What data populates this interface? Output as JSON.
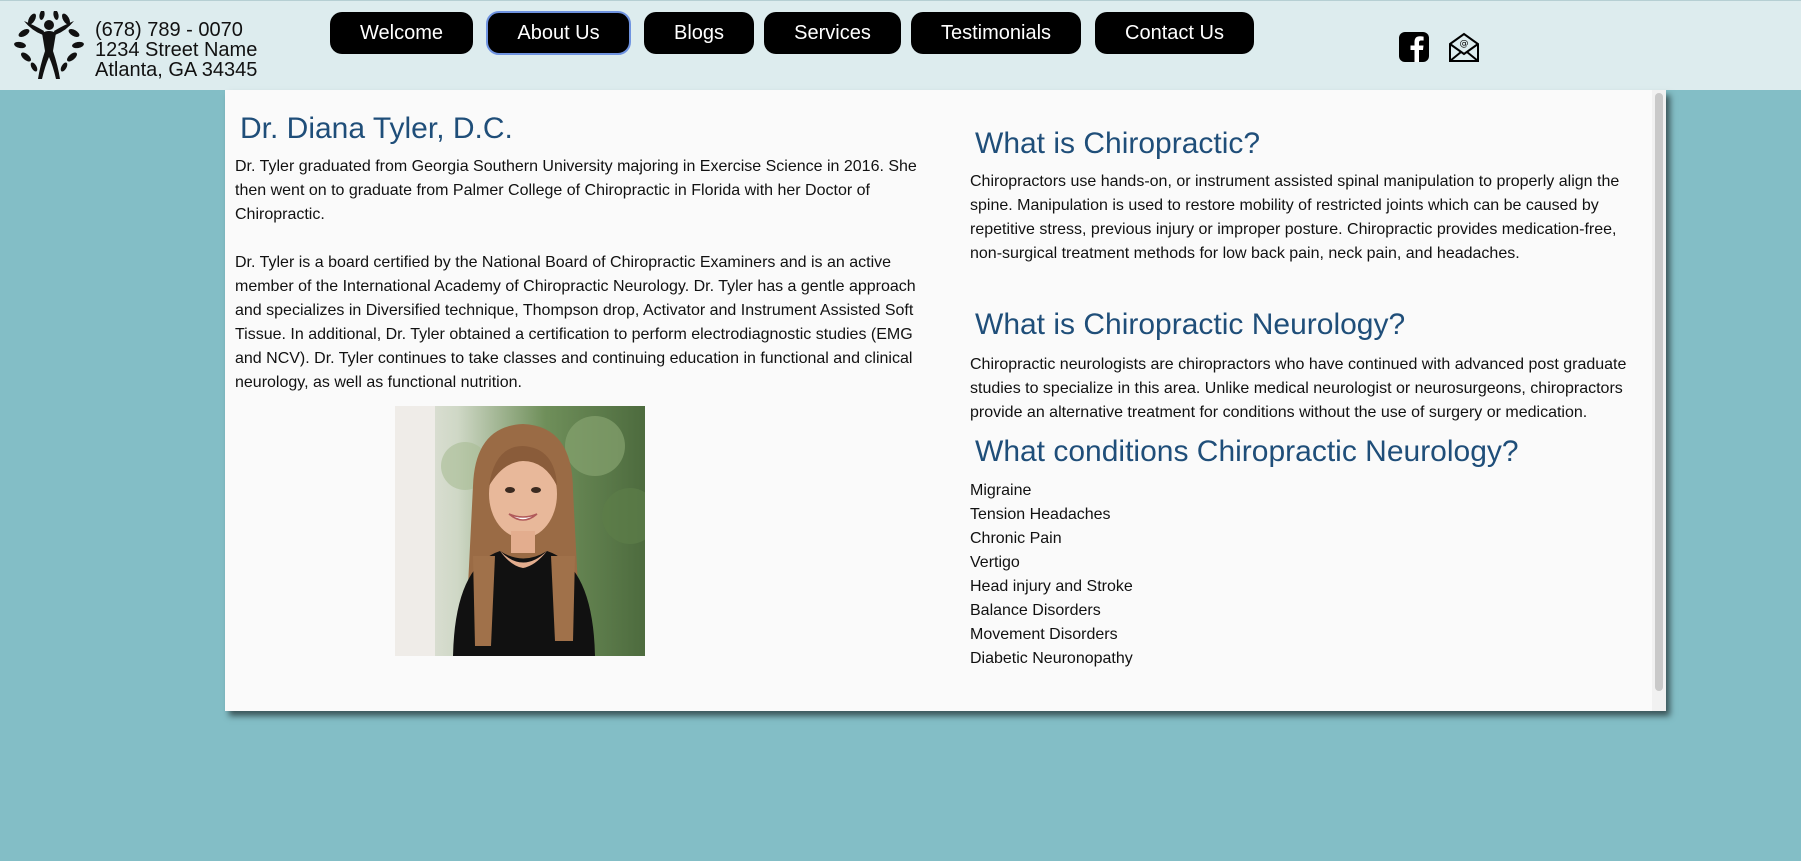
{
  "header": {
    "phone": "(678) 789 - 0070",
    "street": "1234 Street Name",
    "city": "Atlanta, GA 34345"
  },
  "nav": {
    "items": [
      {
        "label": "Welcome"
      },
      {
        "label": "About Us",
        "active": true
      },
      {
        "label": "Blogs"
      },
      {
        "label": "Services"
      },
      {
        "label": "Testimonials"
      },
      {
        "label": "Contact Us"
      }
    ]
  },
  "social": {
    "icons": [
      "facebook-icon",
      "email-icon"
    ]
  },
  "profile": {
    "title": "Dr. Diana Tyler, D.C.",
    "paragraph1": "Dr. Tyler graduated from Georgia Southern University majoring in Exercise Science in 2016. She then went on to graduate from Palmer College of Chiropractic in Florida with her Doctor of Chiropractic.",
    "paragraph2": "Dr. Tyler is a board certified by the National Board of Chiropractic Examiners and is an active member of the International Academy of Chiropractic Neurology. Dr. Tyler has a gentle approach and specializes in Diversified technique, Thompson drop, Activator and Instrument Assisted Soft Tissue. In additional, Dr. Tyler obtained a certification to perform electrodiagnostic studies (EMG and NCV). Dr. Tyler continues to take classes and continuing education in functional and clinical neurology, as well as functional nutrition."
  },
  "chiropractic": {
    "title": "What is Chiropractic?",
    "text": "Chiropractors use hands-on, or instrument assisted spinal manipulation to properly align the spine. Manipulation is used to restore mobility of restricted joints which can be caused by repetitive stress, previous injury or improper posture. Chiropractic provides medication-free, non-surgical treatment methods for low back pain, neck pain, and headaches."
  },
  "neurology": {
    "title": "What is Chiropractic Neurology?",
    "text": "Chiropractic neurologists are chiropractors who have continued with advanced post graduate studies to specialize in this area. Unlike medical neurologist or neurosurgeons, chiropractors provide an alternative treatment for conditions without the use of surgery or medication."
  },
  "conditions": {
    "title": "What conditions Chiropractic Neurology?",
    "items": [
      "Migraine",
      "Tension Headaches",
      "Chronic Pain",
      "Vertigo",
      "Head injury and Stroke",
      "Balance Disorders",
      "Movement Disorders",
      "Diabetic Neuronopathy"
    ]
  },
  "colors": {
    "background": "#83bec6",
    "header": "#ddecee",
    "heading": "#1f4e79",
    "button": "#000000"
  }
}
